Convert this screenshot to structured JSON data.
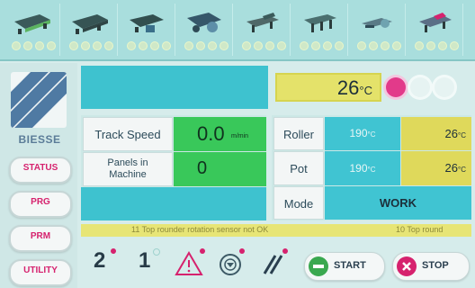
{
  "brand": "BIESSE",
  "machine_strip": {
    "stations": [
      {
        "icon": "machine-station-1-icon",
        "leds": 4
      },
      {
        "icon": "machine-station-2-icon",
        "leds": 4
      },
      {
        "icon": "machine-station-3-icon",
        "leds": 4
      },
      {
        "icon": "machine-station-4-icon",
        "leds": 4
      },
      {
        "icon": "machine-station-5-icon",
        "leds": 4
      },
      {
        "icon": "machine-station-6-icon",
        "leds": 4
      },
      {
        "icon": "machine-station-7-icon",
        "leds": 4
      },
      {
        "icon": "machine-station-8-icon",
        "leds": 4
      }
    ]
  },
  "sidebar": {
    "buttons": [
      {
        "label": "STATUS"
      },
      {
        "label": "PRG"
      },
      {
        "label": "PRM"
      },
      {
        "label": "UTILITY"
      }
    ]
  },
  "header": {
    "temperature": {
      "value": "26",
      "unit": "°C"
    }
  },
  "track": {
    "speed_label": "Track Speed",
    "speed_value": "0.0",
    "speed_unit": "m/min",
    "panels_label_1": "Panels in",
    "panels_label_2": "Machine",
    "panels_value": "0"
  },
  "roller": {
    "rows": [
      {
        "label": "Roller",
        "set": "190",
        "set_unit": "°C",
        "actual": "26",
        "actual_unit": "°C"
      },
      {
        "label": "Pot",
        "set": "190",
        "set_unit": "°C",
        "actual": "26",
        "actual_unit": "°C"
      }
    ],
    "mode_label": "Mode",
    "mode_value": "WORK"
  },
  "ticker": {
    "message_1": "11  Top rounder rotation sensor not OK",
    "message_2": "10  Top round"
  },
  "toolbar": {
    "num_1": "2",
    "num_2": "1",
    "start_label": "START",
    "stop_label": "STOP"
  },
  "colors": {
    "accent_magenta": "#d6226e",
    "cyan": "#3ec2cf",
    "green": "#39c85a",
    "yellow": "#e4e26a"
  }
}
